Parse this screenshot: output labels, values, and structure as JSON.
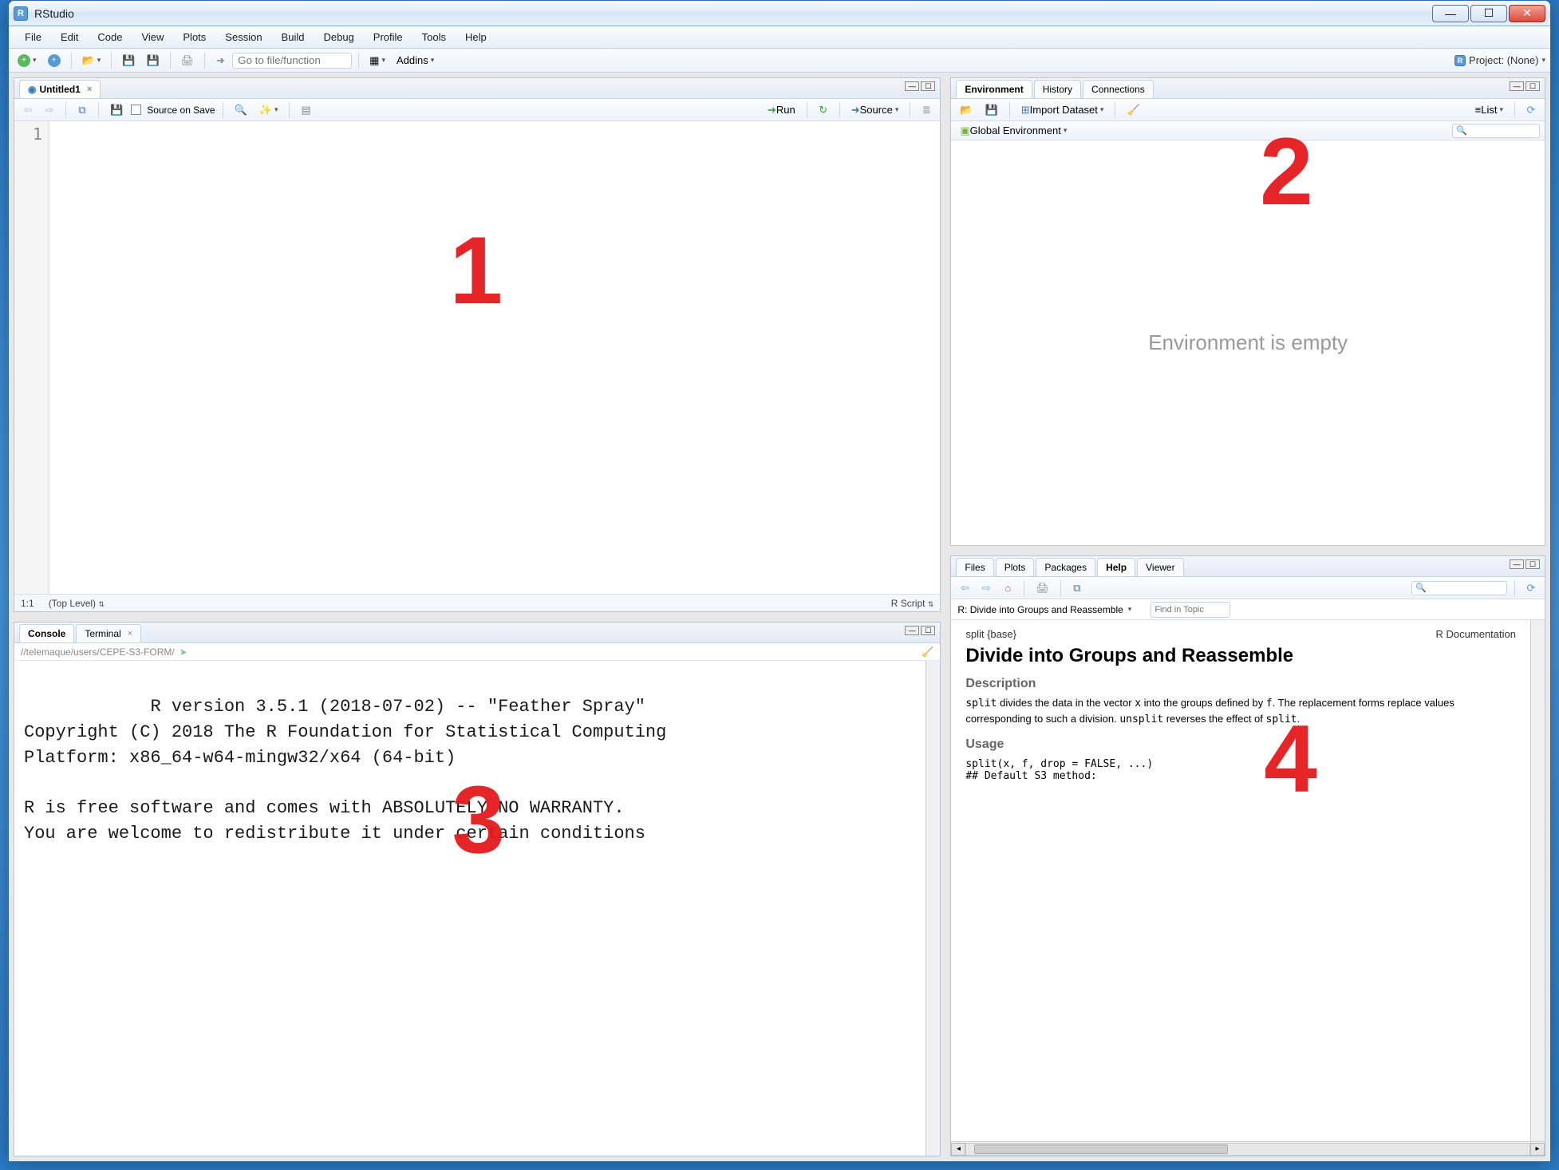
{
  "app": {
    "title": "RStudio"
  },
  "window_controls": {
    "minimize": "—",
    "maximize": "☐",
    "close": "✕"
  },
  "menu": [
    "File",
    "Edit",
    "Code",
    "View",
    "Plots",
    "Session",
    "Build",
    "Debug",
    "Profile",
    "Tools",
    "Help"
  ],
  "toolbar": {
    "goto_placeholder": "Go to file/function",
    "addins_label": "Addins",
    "project_label": "Project: (None)"
  },
  "editor": {
    "tab_name": "Untitled1",
    "source_on_save": "Source on Save",
    "run_label": "Run",
    "source_label": "Source",
    "line_no": "1",
    "status_pos": "1:1",
    "status_scope": "(Top Level)",
    "status_lang": "R Script"
  },
  "console": {
    "tabs": [
      "Console",
      "Terminal"
    ],
    "path": "//telemaque/users/CEPE-S3-FORM/",
    "text": "R version 3.5.1 (2018-07-02) -- \"Feather Spray\"\nCopyright (C) 2018 The R Foundation for Statistical Computing\nPlatform: x86_64-w64-mingw32/x64 (64-bit)\n\nR is free software and comes with ABSOLUTELY NO WARRANTY.\nYou are welcome to redistribute it under certain conditions"
  },
  "env": {
    "tabs": [
      "Environment",
      "History",
      "Connections"
    ],
    "import_label": "Import Dataset",
    "scope": "Global Environment",
    "list_label": "List",
    "empty_text": "Environment is empty"
  },
  "help": {
    "tabs": [
      "Files",
      "Plots",
      "Packages",
      "Help",
      "Viewer"
    ],
    "topic_title": "R: Divide into Groups and Reassemble",
    "find_placeholder": "Find in Topic",
    "pkg": "split {base}",
    "rdoc": "R Documentation",
    "h2": "Divide into Groups and Reassemble",
    "desc_h": "Description",
    "desc": "split divides the data in the vector x into the groups defined by f. The replacement forms replace values corresponding to such a division. unsplit reverses the effect of split.",
    "usage_h": "Usage",
    "usage": "split(x, f, drop = FALSE, ...)\n## Default S3 method:"
  },
  "overlays": {
    "1": "1",
    "2": "2",
    "3": "3",
    "4": "4"
  }
}
